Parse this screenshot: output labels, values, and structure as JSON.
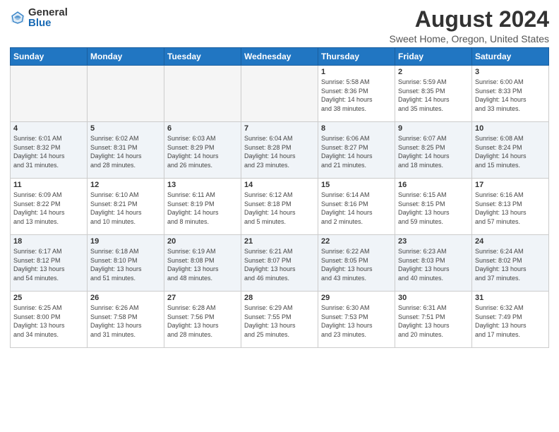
{
  "logo": {
    "general": "General",
    "blue": "Blue"
  },
  "title": "August 2024",
  "subtitle": "Sweet Home, Oregon, United States",
  "weekdays": [
    "Sunday",
    "Monday",
    "Tuesday",
    "Wednesday",
    "Thursday",
    "Friday",
    "Saturday"
  ],
  "weeks": [
    [
      {
        "day": "",
        "info": ""
      },
      {
        "day": "",
        "info": ""
      },
      {
        "day": "",
        "info": ""
      },
      {
        "day": "",
        "info": ""
      },
      {
        "day": "1",
        "info": "Sunrise: 5:58 AM\nSunset: 8:36 PM\nDaylight: 14 hours\nand 38 minutes."
      },
      {
        "day": "2",
        "info": "Sunrise: 5:59 AM\nSunset: 8:35 PM\nDaylight: 14 hours\nand 35 minutes."
      },
      {
        "day": "3",
        "info": "Sunrise: 6:00 AM\nSunset: 8:33 PM\nDaylight: 14 hours\nand 33 minutes."
      }
    ],
    [
      {
        "day": "4",
        "info": "Sunrise: 6:01 AM\nSunset: 8:32 PM\nDaylight: 14 hours\nand 31 minutes."
      },
      {
        "day": "5",
        "info": "Sunrise: 6:02 AM\nSunset: 8:31 PM\nDaylight: 14 hours\nand 28 minutes."
      },
      {
        "day": "6",
        "info": "Sunrise: 6:03 AM\nSunset: 8:29 PM\nDaylight: 14 hours\nand 26 minutes."
      },
      {
        "day": "7",
        "info": "Sunrise: 6:04 AM\nSunset: 8:28 PM\nDaylight: 14 hours\nand 23 minutes."
      },
      {
        "day": "8",
        "info": "Sunrise: 6:06 AM\nSunset: 8:27 PM\nDaylight: 14 hours\nand 21 minutes."
      },
      {
        "day": "9",
        "info": "Sunrise: 6:07 AM\nSunset: 8:25 PM\nDaylight: 14 hours\nand 18 minutes."
      },
      {
        "day": "10",
        "info": "Sunrise: 6:08 AM\nSunset: 8:24 PM\nDaylight: 14 hours\nand 15 minutes."
      }
    ],
    [
      {
        "day": "11",
        "info": "Sunrise: 6:09 AM\nSunset: 8:22 PM\nDaylight: 14 hours\nand 13 minutes."
      },
      {
        "day": "12",
        "info": "Sunrise: 6:10 AM\nSunset: 8:21 PM\nDaylight: 14 hours\nand 10 minutes."
      },
      {
        "day": "13",
        "info": "Sunrise: 6:11 AM\nSunset: 8:19 PM\nDaylight: 14 hours\nand 8 minutes."
      },
      {
        "day": "14",
        "info": "Sunrise: 6:12 AM\nSunset: 8:18 PM\nDaylight: 14 hours\nand 5 minutes."
      },
      {
        "day": "15",
        "info": "Sunrise: 6:14 AM\nSunset: 8:16 PM\nDaylight: 14 hours\nand 2 minutes."
      },
      {
        "day": "16",
        "info": "Sunrise: 6:15 AM\nSunset: 8:15 PM\nDaylight: 13 hours\nand 59 minutes."
      },
      {
        "day": "17",
        "info": "Sunrise: 6:16 AM\nSunset: 8:13 PM\nDaylight: 13 hours\nand 57 minutes."
      }
    ],
    [
      {
        "day": "18",
        "info": "Sunrise: 6:17 AM\nSunset: 8:12 PM\nDaylight: 13 hours\nand 54 minutes."
      },
      {
        "day": "19",
        "info": "Sunrise: 6:18 AM\nSunset: 8:10 PM\nDaylight: 13 hours\nand 51 minutes."
      },
      {
        "day": "20",
        "info": "Sunrise: 6:19 AM\nSunset: 8:08 PM\nDaylight: 13 hours\nand 48 minutes."
      },
      {
        "day": "21",
        "info": "Sunrise: 6:21 AM\nSunset: 8:07 PM\nDaylight: 13 hours\nand 46 minutes."
      },
      {
        "day": "22",
        "info": "Sunrise: 6:22 AM\nSunset: 8:05 PM\nDaylight: 13 hours\nand 43 minutes."
      },
      {
        "day": "23",
        "info": "Sunrise: 6:23 AM\nSunset: 8:03 PM\nDaylight: 13 hours\nand 40 minutes."
      },
      {
        "day": "24",
        "info": "Sunrise: 6:24 AM\nSunset: 8:02 PM\nDaylight: 13 hours\nand 37 minutes."
      }
    ],
    [
      {
        "day": "25",
        "info": "Sunrise: 6:25 AM\nSunset: 8:00 PM\nDaylight: 13 hours\nand 34 minutes."
      },
      {
        "day": "26",
        "info": "Sunrise: 6:26 AM\nSunset: 7:58 PM\nDaylight: 13 hours\nand 31 minutes."
      },
      {
        "day": "27",
        "info": "Sunrise: 6:28 AM\nSunset: 7:56 PM\nDaylight: 13 hours\nand 28 minutes."
      },
      {
        "day": "28",
        "info": "Sunrise: 6:29 AM\nSunset: 7:55 PM\nDaylight: 13 hours\nand 25 minutes."
      },
      {
        "day": "29",
        "info": "Sunrise: 6:30 AM\nSunset: 7:53 PM\nDaylight: 13 hours\nand 23 minutes."
      },
      {
        "day": "30",
        "info": "Sunrise: 6:31 AM\nSunset: 7:51 PM\nDaylight: 13 hours\nand 20 minutes."
      },
      {
        "day": "31",
        "info": "Sunrise: 6:32 AM\nSunset: 7:49 PM\nDaylight: 13 hours\nand 17 minutes."
      }
    ]
  ]
}
